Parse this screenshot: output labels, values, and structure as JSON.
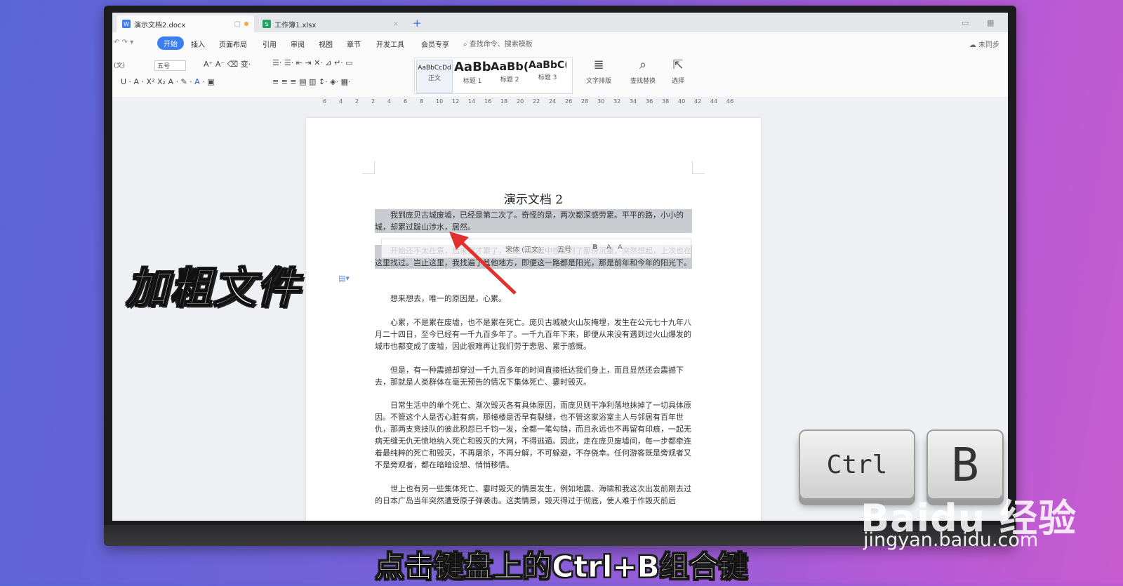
{
  "tabs": [
    {
      "label": "演示文档2.docx",
      "icon": "W",
      "color": "#3b7ef0"
    },
    {
      "label": "工作簿1.xlsx",
      "icon": "S",
      "color": "#1fa463"
    }
  ],
  "menu": {
    "items": [
      "开始",
      "插入",
      "页面布局",
      "引用",
      "审阅",
      "视图",
      "章节",
      "开发工具",
      "会员专享"
    ],
    "active": "开始",
    "search_placeholder": "查找命令、搜索模板",
    "sync": "未同步"
  },
  "ribbon": {
    "font_name": "(文)",
    "font_size": "五号",
    "styles": [
      {
        "sample": "AaBbCcDd",
        "caption": "正文"
      },
      {
        "sample": "AaBb",
        "caption": "标题 1"
      },
      {
        "sample": "AaBb(",
        "caption": "标题 2"
      },
      {
        "sample": "AaBbC(",
        "caption": "标题 3"
      }
    ],
    "text_layout": "文字排版",
    "find_replace": "查找替换",
    "select": "选择"
  },
  "ruler_ticks": [
    "6",
    "4",
    "2",
    "2",
    "4",
    "6",
    "8",
    "10",
    "12",
    "14",
    "16",
    "18",
    "20",
    "22",
    "24",
    "26",
    "28",
    "30",
    "32",
    "34",
    "36",
    "38",
    "40",
    "42",
    "44",
    "46"
  ],
  "document": {
    "title": "演示文档 2",
    "paragraphs": [
      "我到庞贝古城废墟，已经是第二次了。奇怪的是，两次都深感劳累。平平的路，小小的城，却累过跋山涉水，居然。",
      "开始还不太在意，后来我才累了，在这个过程中感受到了那份沉重，突然想起，上次也在这里找过。岂止这里，我找遍了其他地方，即便这一路都是阳光，那是前年和今年的阳光下。",
      "想来想去，唯一的原因是，心累。",
      "心累，不是累在废墟，也不是累在死亡。庞贝古城被火山灰掩埋，发生在公元七十九年八月二十四日，至今已经有一千九百多年了。一千九百年下来，即便从来没有遇到过火山爆发的城市也都变成了废墟，因此很难再让我们劳于悲思、累于感慨。",
      "但是，有一种震撼却穿过一千九百多年的时间直接抵达我们身上，而且显然还会震撼下去，那就是人类群体在毫无预告的情况下集体死亡、霎时毁灭。",
      "日常生活中的单个死亡、渐次毁灭各有具体原因，而庞贝则干净利落地抹掉了一切具体原因。不管这个人是否心脏有病，那幢楼是否早有裂缝，也不管这家浴室主人与邻居有百年世仇，那两支竞技队的彼此积怨已千钧一发，全都一笔勾销，而且永远也不再留有印痕，一起无病无缝无仇无愤地纳入死亡和毁灭的大网，不得逃遁。因此，走在庞贝废墟间，每一步都牵连着最纯粹的死亡和毁灭，不再屠杀，不再分解，不可躲避，不存侥幸。任何游客既是旁观者又不是旁观者，都在暗暗设想、悄悄移情。",
      "世上也有另一些集体死亡、霎时毁灭的情景发生，例如地震、海啸和我这次出发前刚去过的日本广岛当年突然遭受原子弹袭击。这类情景，毁灭得过于彻底，使人难于作毁灭前后"
    ],
    "mini_toolbar": [
      "宋体 (正文)",
      "五号",
      "B",
      "A",
      "A"
    ]
  },
  "overlay": {
    "label": "加粗文件",
    "keys": [
      "Ctrl",
      "B"
    ],
    "watermark": "Baidu 经验",
    "watermark_url": "jingyan.baidu.com",
    "caption": "点击键盘上的Ctrl+B组合键"
  }
}
